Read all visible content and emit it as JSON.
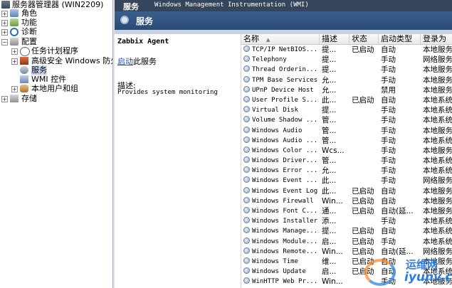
{
  "tree": {
    "root": "服务器管理器 (WIN2209)",
    "items": [
      {
        "label": "角色",
        "expander": "+",
        "icon": "roles-icon"
      },
      {
        "label": "功能",
        "expander": "+",
        "icon": "features-icon"
      },
      {
        "label": "诊断",
        "expander": "+",
        "icon": "diagnostics-icon"
      },
      {
        "label": "配置",
        "expander": "-",
        "icon": "configuration-icon"
      },
      {
        "label": "任务计划程序",
        "expander": "+",
        "icon": "task-scheduler-icon"
      },
      {
        "label": "高级安全 Windows 防火墙",
        "expander": "+",
        "icon": "firewall-icon"
      },
      {
        "label": "服务",
        "expander": "",
        "icon": "services-icon"
      },
      {
        "label": "WMI 控件",
        "expander": "",
        "icon": "wmi-icon"
      },
      {
        "label": "本地用户和组",
        "expander": "+",
        "icon": "users-icon"
      },
      {
        "label": "存储",
        "expander": "+",
        "icon": "storage-icon"
      }
    ]
  },
  "topbar": {
    "section": "服务",
    "wmi_title": "Windows Management Instrumentation (WMI)"
  },
  "subbar": {
    "title": "服务"
  },
  "detail": {
    "service_name": "Zabbix Agent",
    "start_link": "启动",
    "start_suffix": "此服务",
    "desc_label": "描述:",
    "desc": "Provides system monitoring"
  },
  "columns": {
    "name": "名称",
    "desc": "描述",
    "status": "状态",
    "start": "启动类型",
    "logon": "登录为"
  },
  "services": [
    {
      "name": "TCP/IP NetBIOS...",
      "desc": "提...",
      "status": "已启动",
      "start": "自动",
      "logon": "本地服务"
    },
    {
      "name": "Telephony",
      "desc": "提...",
      "status": "",
      "start": "手动",
      "logon": "网络服务"
    },
    {
      "name": "Thread Orderin...",
      "desc": "提...",
      "status": "",
      "start": "手动",
      "logon": "本地服务"
    },
    {
      "name": "TPM Base Services",
      "desc": "允...",
      "status": "",
      "start": "手动",
      "logon": "本地服务"
    },
    {
      "name": "UPnP Device Host",
      "desc": "允...",
      "status": "",
      "start": "禁用",
      "logon": "本地服务"
    },
    {
      "name": "User Profile S...",
      "desc": "此...",
      "status": "已启动",
      "start": "自动",
      "logon": "本地系统"
    },
    {
      "name": "Virtual Disk",
      "desc": "提...",
      "status": "",
      "start": "手动",
      "logon": "本地系统"
    },
    {
      "name": "Volume Shadow ...",
      "desc": "管...",
      "status": "",
      "start": "手动",
      "logon": "本地系统"
    },
    {
      "name": "Windows Audio",
      "desc": "管...",
      "status": "",
      "start": "手动",
      "logon": "本地服务"
    },
    {
      "name": "Windows Audio ...",
      "desc": "管...",
      "status": "",
      "start": "手动",
      "logon": "本地系统"
    },
    {
      "name": "Windows Color ...",
      "desc": "Wcs...",
      "status": "",
      "start": "手动",
      "logon": "本地服务"
    },
    {
      "name": "Windows Driver...",
      "desc": "管...",
      "status": "",
      "start": "手动",
      "logon": "本地系统"
    },
    {
      "name": "Windows Error ...",
      "desc": "允...",
      "status": "",
      "start": "手动",
      "logon": "本地系统"
    },
    {
      "name": "Windows Event ...",
      "desc": "此...",
      "status": "",
      "start": "手动",
      "logon": "网络服务"
    },
    {
      "name": "Windows Event Log",
      "desc": "此...",
      "status": "已启动",
      "start": "自动",
      "logon": "本地服务"
    },
    {
      "name": "Windows Firewall",
      "desc": "Win...",
      "status": "已启动",
      "start": "自动",
      "logon": "本地服务"
    },
    {
      "name": "Windows Font C...",
      "desc": "通...",
      "status": "已启动",
      "start": "自动(延...",
      "logon": "本地服务"
    },
    {
      "name": "Windows Installer",
      "desc": "添...",
      "status": "",
      "start": "手动",
      "logon": "本地系统"
    },
    {
      "name": "Windows Manage...",
      "desc": "提...",
      "status": "已启动",
      "start": "自动",
      "logon": "本地系统"
    },
    {
      "name": "Windows Module...",
      "desc": "启...",
      "status": "已启动",
      "start": "手动",
      "logon": "本地系统"
    },
    {
      "name": "Windows Remote...",
      "desc": "Win...",
      "status": "已启动",
      "start": "自动(延...",
      "logon": "网络服务"
    },
    {
      "name": "Windows Time",
      "desc": "维...",
      "status": "已启动",
      "start": "自动",
      "logon": "本地服务"
    },
    {
      "name": "Windows Update",
      "desc": "启...",
      "status": "已启动",
      "start": "自动",
      "logon": "本地系统"
    },
    {
      "name": "WinHTTP Web Pr...",
      "desc": "Win...",
      "status": "",
      "start": "手动",
      "logon": "本地服务"
    }
  ],
  "watermark": {
    "cn": "运维网",
    "en": "iyunv.com"
  }
}
